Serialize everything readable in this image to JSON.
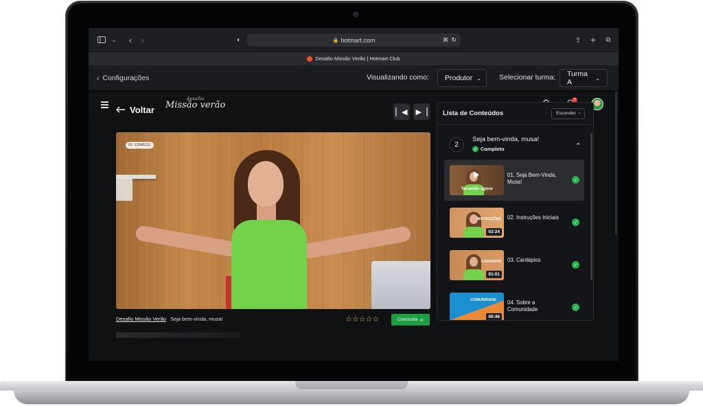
{
  "browser": {
    "url": "hotmart.com",
    "tab_title": "Desafio Missão Verão | Hotmart Club"
  },
  "topbar": {
    "back_label": "Configurações",
    "viewing_as_label": "Visualizando como:",
    "viewing_as_value": "Produtor",
    "select_class_label": "Selecionar turma:",
    "select_class_value": "Turma A"
  },
  "header": {
    "logo_small": "desafio",
    "logo_big": "Missão verão",
    "notification_count": "0"
  },
  "player": {
    "back_label": "Voltar",
    "video_id": "ID: 13345211",
    "course_link": "Desafio Missão Verão",
    "lesson_name": "Seja bem-vinda, musa!",
    "rating_stars": "☆☆☆☆☆",
    "complete_label": "Concluída"
  },
  "sidebar": {
    "title": "Lista de Conteúdos",
    "hide_label": "Esconder",
    "module": {
      "number": "2",
      "title": "Seja bem-vinda, musa!",
      "status": "Completo"
    },
    "lessons": [
      {
        "title": "01. Seja Bem-Vinda, Musa!",
        "overlay": "Tocando agora",
        "thumb_word": "",
        "duration": ""
      },
      {
        "title": "02. Instruções Iniciais",
        "overlay": "",
        "thumb_word": "INSTRUÇÕES",
        "duration": "02:24"
      },
      {
        "title": "03. Cardápios",
        "overlay": "",
        "thumb_word": "CARDÁPIO",
        "duration": "01:01"
      },
      {
        "title": "04. Sobre a Comunidade",
        "overlay": "",
        "thumb_word": "COMUNIDADE",
        "duration": "00:46"
      }
    ]
  },
  "colors": {
    "accent_green": "#25b350",
    "complete_button": "#1f9d45",
    "background": "#101113"
  }
}
